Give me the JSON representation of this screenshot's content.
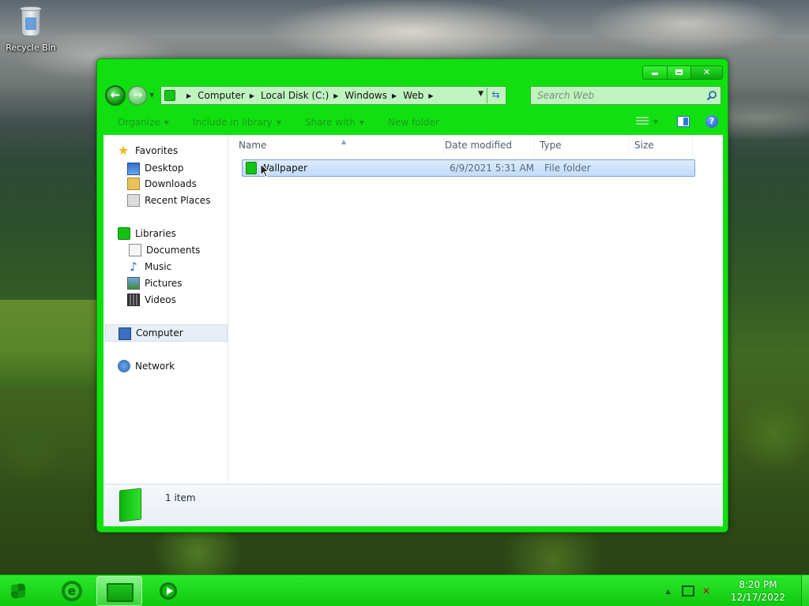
{
  "desktop": {
    "icons": [
      {
        "label": "Recycle Bin",
        "icon": "recycle-bin-icon"
      }
    ]
  },
  "window": {
    "caption_buttons": {
      "minimize": "minimize",
      "maximize": "maximize",
      "close": "✕"
    },
    "address": {
      "crumbs": [
        "Computer",
        "Local Disk (C:)",
        "Windows",
        "Web"
      ]
    },
    "search": {
      "placeholder": "Search Web"
    },
    "toolbar": {
      "items": [
        "Organize",
        "Include in library",
        "Share with",
        "New folder"
      ]
    },
    "nav_pane": {
      "favorites": {
        "label": "Favorites",
        "items": [
          "Desktop",
          "Downloads",
          "Recent Places"
        ]
      },
      "libraries": {
        "label": "Libraries",
        "items": [
          "Documents",
          "Music",
          "Pictures",
          "Videos"
        ]
      },
      "computer": "Computer",
      "network": "Network"
    },
    "columns": [
      "Name",
      "Date modified",
      "Type",
      "Size"
    ],
    "files": [
      {
        "name": "Wallpaper",
        "date_modified": "6/9/2021 5:31 AM",
        "type": "File folder",
        "size": ""
      }
    ],
    "details": {
      "count": "1 item"
    }
  },
  "taskbar": {
    "pinned": [
      "start-button",
      "internet-explorer",
      "windows-explorer",
      "media-player"
    ],
    "clock": {
      "time": "8:20 PM",
      "date": "12/17/2022"
    }
  },
  "colors": {
    "accent": "#10e010",
    "taskbar": "#16d016",
    "selection": "#c1dcfc"
  }
}
